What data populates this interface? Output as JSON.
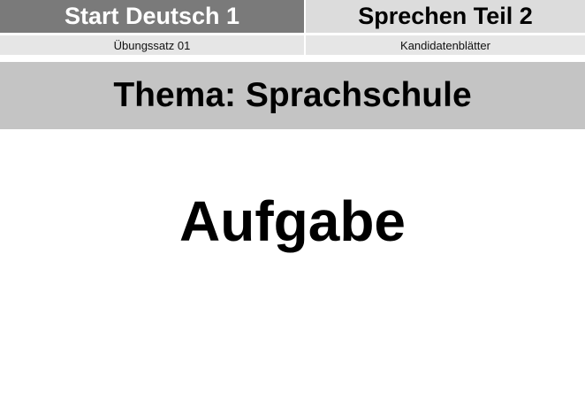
{
  "header": {
    "left_title": "Start Deutsch 1",
    "right_title": "Sprechen Teil 2"
  },
  "subheader": {
    "left_text": "Übungssatz 01",
    "right_text": "Kandidatenblätter"
  },
  "theme": {
    "label": "Thema: Sprachschule"
  },
  "main": {
    "task_title": "Aufgabe"
  },
  "colors": {
    "header_left_bg": "#7a7a7a",
    "header_right_bg": "#dcdcdc",
    "subheader_bg": "#e6e6e6",
    "theme_bg": "#c4c4c4",
    "text": "#000000"
  }
}
